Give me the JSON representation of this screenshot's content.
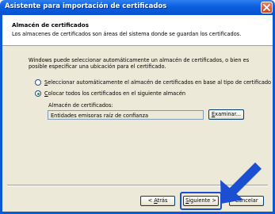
{
  "window": {
    "title": "Asistente para importación de certificados"
  },
  "header": {
    "title": "Almacén de certificados",
    "subtitle": "Los almacenes de certificados son áreas del sistema donde se guardan los certificados."
  },
  "body": {
    "description": "Windows puede seleccionar automáticamente un almacén de certificados, o bien es posible especificar una ubicación para el certificado."
  },
  "options": {
    "auto_select_mnemonic": "S",
    "auto_select_rest": "eleccionar automáticamente el almacén de certificados en base al tipo de certificado",
    "place_all_mnemonic": "C",
    "place_all_rest": "olocar todos los certificados en el siguiente almacén",
    "selected": "place_all"
  },
  "store": {
    "label": "Almacén de certificados:",
    "value": "Entidades emisoras raíz de confianza",
    "browse_mnemonic": "E",
    "browse_rest": "xaminar..."
  },
  "footer": {
    "back_prefix": "< ",
    "back_mnemonic": "A",
    "back_rest": "trás",
    "next_mnemonic": "S",
    "next_rest": "iguiente >",
    "cancel": "Cancelar"
  },
  "colors": {
    "title_bar": "#0a5fe0",
    "close_button": "#d2401a",
    "highlight_arrow": "#1a4fd1",
    "dialog_bg": "#ece9d8"
  },
  "icons": {
    "close": "close-icon",
    "pointer": "pointer-arrow-icon"
  }
}
